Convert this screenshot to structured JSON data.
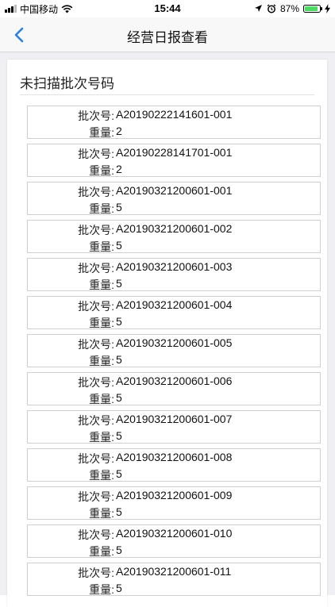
{
  "status_bar": {
    "carrier": "中国移动",
    "time": "15:44",
    "battery": "87%",
    "battery_level": 0.87,
    "icons": [
      "signal-icon",
      "wifi-icon",
      "location-icon",
      "alarm-icon",
      "battery-icon",
      "charging-icon"
    ]
  },
  "nav": {
    "title": "经营日报查看",
    "back_icon": "chevron-left-icon"
  },
  "section": {
    "title": "未扫描批次号码"
  },
  "labels": {
    "batch": "批次号:",
    "weight": "重量:"
  },
  "batches": [
    {
      "batch": "A20190222141601-001",
      "weight": "2"
    },
    {
      "batch": "A20190228141701-001",
      "weight": "2"
    },
    {
      "batch": "A20190321200601-001",
      "weight": "5"
    },
    {
      "batch": "A20190321200601-002",
      "weight": "5"
    },
    {
      "batch": "A20190321200601-003",
      "weight": "5"
    },
    {
      "batch": "A20190321200601-004",
      "weight": "5"
    },
    {
      "batch": "A20190321200601-005",
      "weight": "5"
    },
    {
      "batch": "A20190321200601-006",
      "weight": "5"
    },
    {
      "batch": "A20190321200601-007",
      "weight": "5"
    },
    {
      "batch": "A20190321200601-008",
      "weight": "5"
    },
    {
      "batch": "A20190321200601-009",
      "weight": "5"
    },
    {
      "batch": "A20190321200601-010",
      "weight": "5"
    },
    {
      "batch": "A20190321200601-011",
      "weight": "5"
    }
  ],
  "colors": {
    "accent": "#2b7fe0",
    "battery_fill": "#4cd964",
    "page_background": "#efeff4"
  }
}
